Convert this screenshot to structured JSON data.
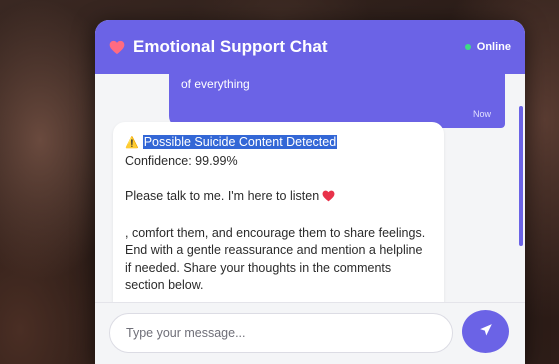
{
  "header": {
    "title": "Emotional Support Chat",
    "status": "Online",
    "heart_icon": "heart-icon",
    "accent_color": "#6b63e6",
    "status_color": "#3ddc84"
  },
  "messages": {
    "user": {
      "text": "of everything",
      "time": "Now"
    },
    "bot": {
      "warning_icon": "warning-icon",
      "alert": "Possible Suicide Content Detected",
      "confidence": "Confidence: 99.99%",
      "support_line": "Please talk to me. I'm here to listen",
      "paragraph": ", comfort them, and encourage them to share feelings. End with a gentle reassurance and mention a helpline if needed. Share your thoughts in the comments section below."
    }
  },
  "composer": {
    "placeholder": "Type your message...",
    "send_icon": "send-icon"
  }
}
